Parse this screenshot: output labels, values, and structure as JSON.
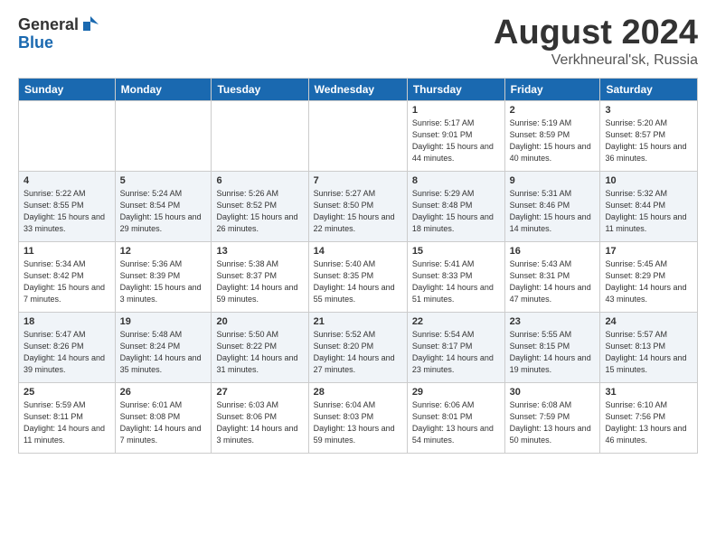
{
  "header": {
    "logo_general": "General",
    "logo_blue": "Blue",
    "title": "August 2024",
    "location": "Verkhneural'sk, Russia"
  },
  "weekdays": [
    "Sunday",
    "Monday",
    "Tuesday",
    "Wednesday",
    "Thursday",
    "Friday",
    "Saturday"
  ],
  "weeks": [
    [
      {
        "day": "",
        "sunrise": "",
        "sunset": "",
        "daylight": ""
      },
      {
        "day": "",
        "sunrise": "",
        "sunset": "",
        "daylight": ""
      },
      {
        "day": "",
        "sunrise": "",
        "sunset": "",
        "daylight": ""
      },
      {
        "day": "",
        "sunrise": "",
        "sunset": "",
        "daylight": ""
      },
      {
        "day": "1",
        "sunrise": "Sunrise: 5:17 AM",
        "sunset": "Sunset: 9:01 PM",
        "daylight": "Daylight: 15 hours and 44 minutes."
      },
      {
        "day": "2",
        "sunrise": "Sunrise: 5:19 AM",
        "sunset": "Sunset: 8:59 PM",
        "daylight": "Daylight: 15 hours and 40 minutes."
      },
      {
        "day": "3",
        "sunrise": "Sunrise: 5:20 AM",
        "sunset": "Sunset: 8:57 PM",
        "daylight": "Daylight: 15 hours and 36 minutes."
      }
    ],
    [
      {
        "day": "4",
        "sunrise": "Sunrise: 5:22 AM",
        "sunset": "Sunset: 8:55 PM",
        "daylight": "Daylight: 15 hours and 33 minutes."
      },
      {
        "day": "5",
        "sunrise": "Sunrise: 5:24 AM",
        "sunset": "Sunset: 8:54 PM",
        "daylight": "Daylight: 15 hours and 29 minutes."
      },
      {
        "day": "6",
        "sunrise": "Sunrise: 5:26 AM",
        "sunset": "Sunset: 8:52 PM",
        "daylight": "Daylight: 15 hours and 26 minutes."
      },
      {
        "day": "7",
        "sunrise": "Sunrise: 5:27 AM",
        "sunset": "Sunset: 8:50 PM",
        "daylight": "Daylight: 15 hours and 22 minutes."
      },
      {
        "day": "8",
        "sunrise": "Sunrise: 5:29 AM",
        "sunset": "Sunset: 8:48 PM",
        "daylight": "Daylight: 15 hours and 18 minutes."
      },
      {
        "day": "9",
        "sunrise": "Sunrise: 5:31 AM",
        "sunset": "Sunset: 8:46 PM",
        "daylight": "Daylight: 15 hours and 14 minutes."
      },
      {
        "day": "10",
        "sunrise": "Sunrise: 5:32 AM",
        "sunset": "Sunset: 8:44 PM",
        "daylight": "Daylight: 15 hours and 11 minutes."
      }
    ],
    [
      {
        "day": "11",
        "sunrise": "Sunrise: 5:34 AM",
        "sunset": "Sunset: 8:42 PM",
        "daylight": "Daylight: 15 hours and 7 minutes."
      },
      {
        "day": "12",
        "sunrise": "Sunrise: 5:36 AM",
        "sunset": "Sunset: 8:39 PM",
        "daylight": "Daylight: 15 hours and 3 minutes."
      },
      {
        "day": "13",
        "sunrise": "Sunrise: 5:38 AM",
        "sunset": "Sunset: 8:37 PM",
        "daylight": "Daylight: 14 hours and 59 minutes."
      },
      {
        "day": "14",
        "sunrise": "Sunrise: 5:40 AM",
        "sunset": "Sunset: 8:35 PM",
        "daylight": "Daylight: 14 hours and 55 minutes."
      },
      {
        "day": "15",
        "sunrise": "Sunrise: 5:41 AM",
        "sunset": "Sunset: 8:33 PM",
        "daylight": "Daylight: 14 hours and 51 minutes."
      },
      {
        "day": "16",
        "sunrise": "Sunrise: 5:43 AM",
        "sunset": "Sunset: 8:31 PM",
        "daylight": "Daylight: 14 hours and 47 minutes."
      },
      {
        "day": "17",
        "sunrise": "Sunrise: 5:45 AM",
        "sunset": "Sunset: 8:29 PM",
        "daylight": "Daylight: 14 hours and 43 minutes."
      }
    ],
    [
      {
        "day": "18",
        "sunrise": "Sunrise: 5:47 AM",
        "sunset": "Sunset: 8:26 PM",
        "daylight": "Daylight: 14 hours and 39 minutes."
      },
      {
        "day": "19",
        "sunrise": "Sunrise: 5:48 AM",
        "sunset": "Sunset: 8:24 PM",
        "daylight": "Daylight: 14 hours and 35 minutes."
      },
      {
        "day": "20",
        "sunrise": "Sunrise: 5:50 AM",
        "sunset": "Sunset: 8:22 PM",
        "daylight": "Daylight: 14 hours and 31 minutes."
      },
      {
        "day": "21",
        "sunrise": "Sunrise: 5:52 AM",
        "sunset": "Sunset: 8:20 PM",
        "daylight": "Daylight: 14 hours and 27 minutes."
      },
      {
        "day": "22",
        "sunrise": "Sunrise: 5:54 AM",
        "sunset": "Sunset: 8:17 PM",
        "daylight": "Daylight: 14 hours and 23 minutes."
      },
      {
        "day": "23",
        "sunrise": "Sunrise: 5:55 AM",
        "sunset": "Sunset: 8:15 PM",
        "daylight": "Daylight: 14 hours and 19 minutes."
      },
      {
        "day": "24",
        "sunrise": "Sunrise: 5:57 AM",
        "sunset": "Sunset: 8:13 PM",
        "daylight": "Daylight: 14 hours and 15 minutes."
      }
    ],
    [
      {
        "day": "25",
        "sunrise": "Sunrise: 5:59 AM",
        "sunset": "Sunset: 8:11 PM",
        "daylight": "Daylight: 14 hours and 11 minutes."
      },
      {
        "day": "26",
        "sunrise": "Sunrise: 6:01 AM",
        "sunset": "Sunset: 8:08 PM",
        "daylight": "Daylight: 14 hours and 7 minutes."
      },
      {
        "day": "27",
        "sunrise": "Sunrise: 6:03 AM",
        "sunset": "Sunset: 8:06 PM",
        "daylight": "Daylight: 14 hours and 3 minutes."
      },
      {
        "day": "28",
        "sunrise": "Sunrise: 6:04 AM",
        "sunset": "Sunset: 8:03 PM",
        "daylight": "Daylight: 13 hours and 59 minutes."
      },
      {
        "day": "29",
        "sunrise": "Sunrise: 6:06 AM",
        "sunset": "Sunset: 8:01 PM",
        "daylight": "Daylight: 13 hours and 54 minutes."
      },
      {
        "day": "30",
        "sunrise": "Sunrise: 6:08 AM",
        "sunset": "Sunset: 7:59 PM",
        "daylight": "Daylight: 13 hours and 50 minutes."
      },
      {
        "day": "31",
        "sunrise": "Sunrise: 6:10 AM",
        "sunset": "Sunset: 7:56 PM",
        "daylight": "Daylight: 13 hours and 46 minutes."
      }
    ]
  ]
}
